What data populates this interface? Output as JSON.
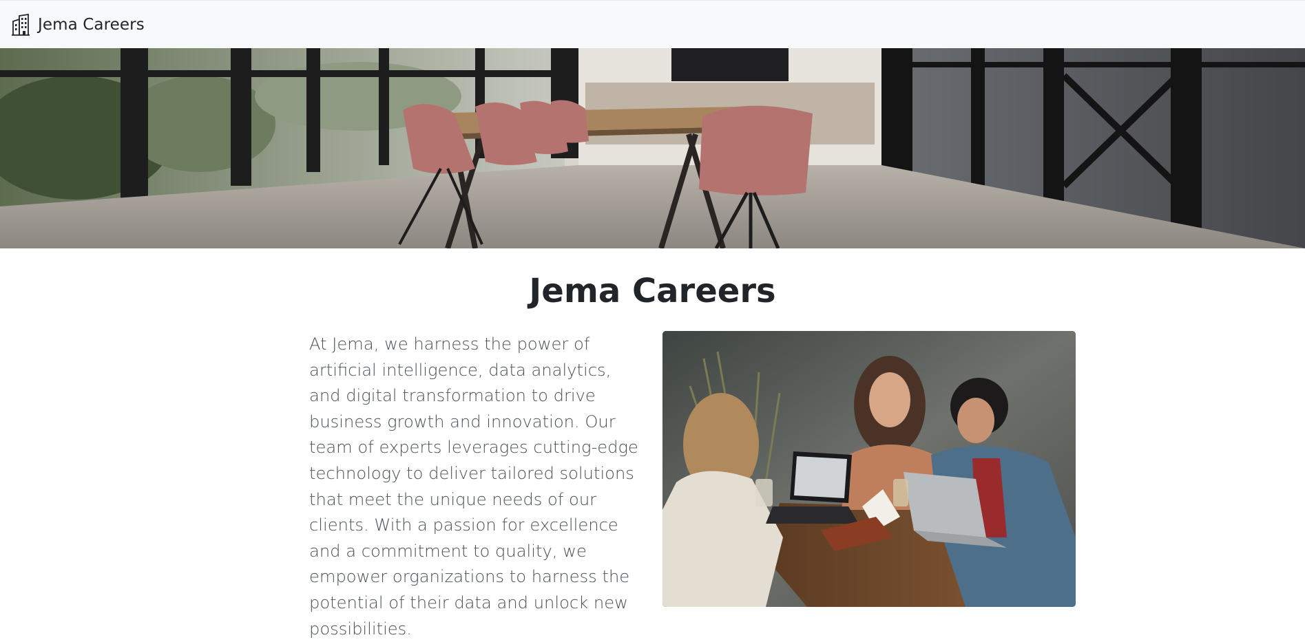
{
  "navbar": {
    "brand_icon": "building-icon",
    "brand_text": "Jema Careers"
  },
  "hero": {
    "image_icon": "office-meeting-room-image"
  },
  "main": {
    "title": "Jema Careers",
    "intro_text": "At Jema, we harness the power of artificial intelligence, data analytics, and digital transformation to drive business growth and innovation. Our team of experts leverages cutting-edge technology to deliver tailored solutions that meet the unique needs of our clients. With a passion for excellence and a commitment to quality, we empower organizations to harness the potential of their data and unlock new possibilities.",
    "team_photo_icon": "team-collaboration-image"
  },
  "colors": {
    "navbar_bg": "#f8f9fa",
    "title_text": "#212529",
    "body_text": "#495057"
  }
}
